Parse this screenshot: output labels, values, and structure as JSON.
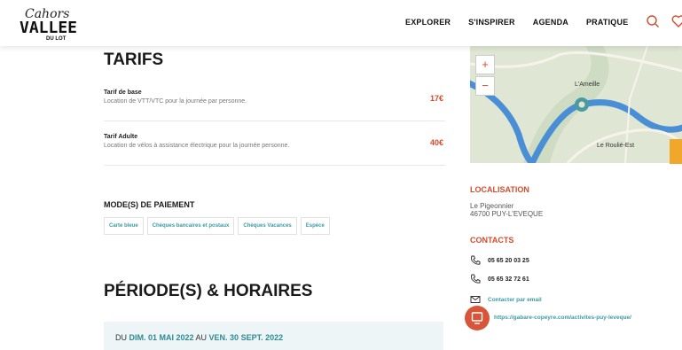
{
  "header": {
    "logo": {
      "line1": "Cahors",
      "line2": "VALLEE",
      "line3": "DU LOT"
    },
    "nav": [
      "EXPLORER",
      "S'INSPIRER",
      "AGENDA",
      "PRATIQUE"
    ],
    "icons": [
      "search-icon",
      "heart-icon"
    ]
  },
  "tarifs": {
    "title": "TARIFS",
    "rows": [
      {
        "name": "Tarif de base",
        "desc": "Location de VTT/VTC pour la journée par personne.",
        "price": "17€"
      },
      {
        "name": "Tarif Adulte",
        "desc": "Location de vélos à assistance électrique pour la journée personne.",
        "price": "40€"
      }
    ]
  },
  "payment": {
    "title": "MODE(S) DE PAIEMENT",
    "methods": [
      "Carte bleue",
      "Chèques bancaires et postaux",
      "Chèques Vacances",
      "Espèce"
    ]
  },
  "periods": {
    "title": "PÉRIODE(S) & HORAIRES",
    "prefix": "DU ",
    "start": "DIM. 01 MAI 2022",
    "middle": " AU ",
    "end": "VEN. 30 SEPT. 2022"
  },
  "map": {
    "zoom_in": "+",
    "zoom_out": "−",
    "labels": {
      "place1": "L'Ameille",
      "place2": "Le Roulié-Est"
    },
    "colors": {
      "land": "#dfe6d4",
      "river": "#4a8fd6",
      "road": "#f7f3ea",
      "marker": "#4a9aa0"
    }
  },
  "localisation": {
    "title": "LOCALISATION",
    "line1": "Le Pigeonnier",
    "line2": "46700 PUY-L'EVEQUE"
  },
  "contacts": {
    "title": "CONTACTS",
    "phone1": "05 65 20 03 25",
    "phone2": "05 65 32 72 61",
    "email_label": "Contacter par email",
    "website": "https://gabare-copeyre.com/activites-puy-leveque/"
  },
  "colors": {
    "accent": "#d44b2c",
    "teal": "#3e9aa3",
    "period_bg": "#eef5f6"
  }
}
